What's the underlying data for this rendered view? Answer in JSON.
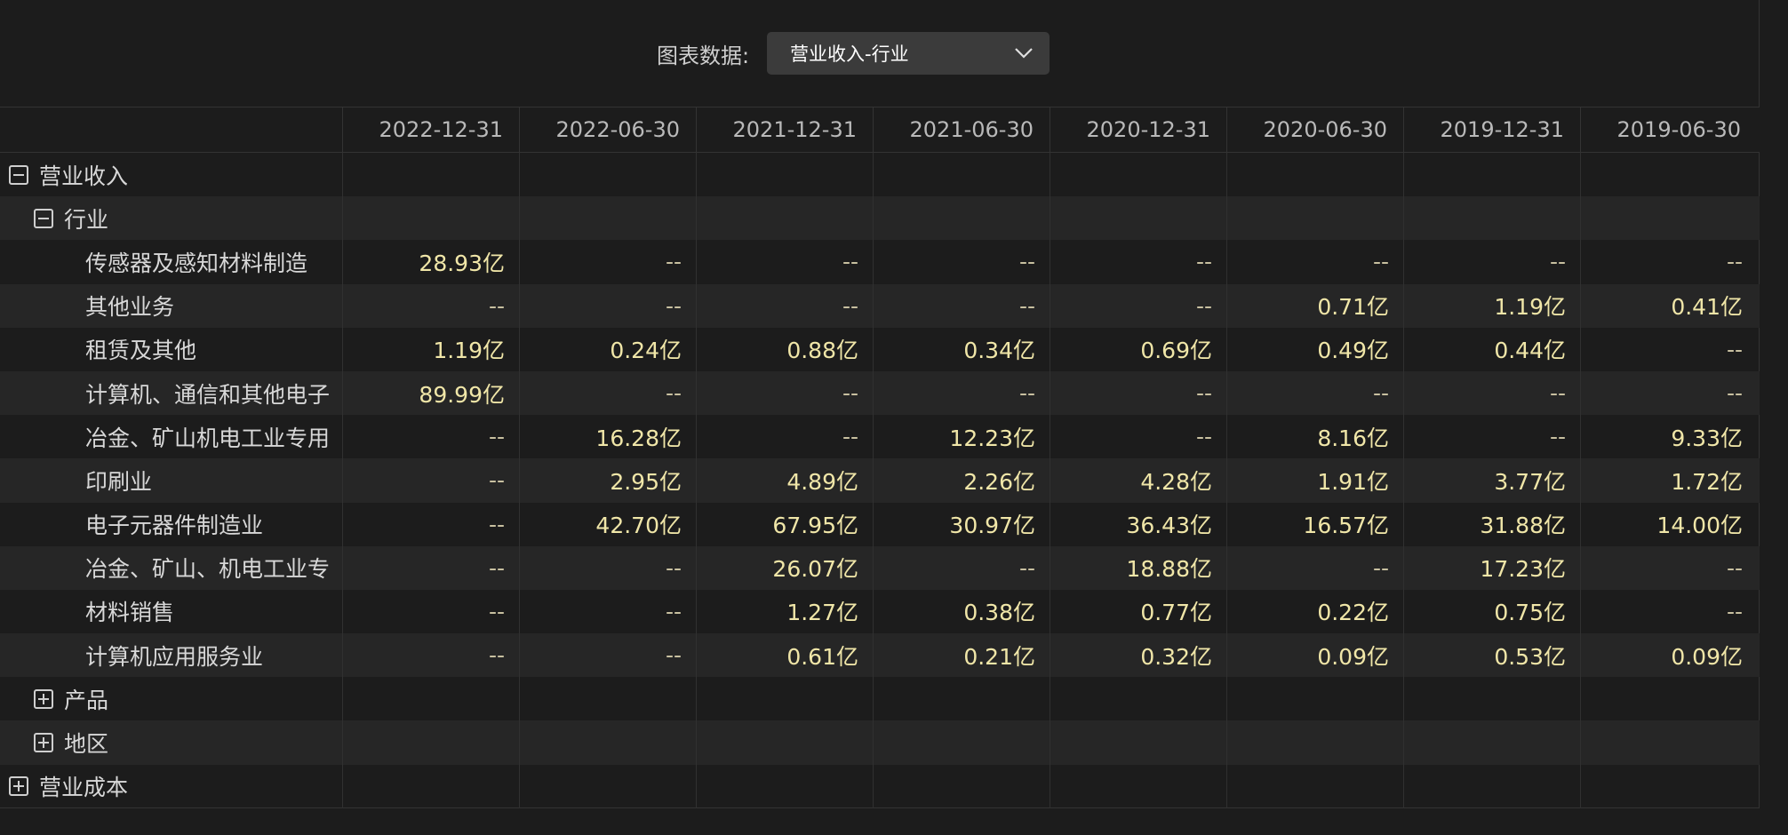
{
  "toolbar": {
    "label": "图表数据:",
    "select_value": "营业收入-行业",
    "select_icon": "chevron-down-icon"
  },
  "table": {
    "columns": [
      "2022-12-31",
      "2022-06-30",
      "2021-12-31",
      "2021-06-30",
      "2020-12-31",
      "2020-06-30",
      "2019-12-31",
      "2019-06-30"
    ],
    "rows": [
      {
        "label": "营业收入",
        "level": 0,
        "toggle": "collapse",
        "cells": [
          "",
          "",
          "",
          "",
          "",
          "",
          "",
          ""
        ]
      },
      {
        "label": "行业",
        "level": 1,
        "toggle": "collapse",
        "cells": [
          "",
          "",
          "",
          "",
          "",
          "",
          "",
          ""
        ]
      },
      {
        "label": "传感器及感知材料制造",
        "level": 2,
        "cells": [
          "28.93亿",
          "--",
          "--",
          "--",
          "--",
          "--",
          "--",
          "--"
        ]
      },
      {
        "label": "其他业务",
        "level": 2,
        "cells": [
          "--",
          "--",
          "--",
          "--",
          "--",
          "0.71亿",
          "1.19亿",
          "0.41亿"
        ]
      },
      {
        "label": "租赁及其他",
        "level": 2,
        "cells": [
          "1.19亿",
          "0.24亿",
          "0.88亿",
          "0.34亿",
          "0.69亿",
          "0.49亿",
          "0.44亿",
          "--"
        ]
      },
      {
        "label": "计算机、通信和其他电子",
        "level": 2,
        "cells": [
          "89.99亿",
          "--",
          "--",
          "--",
          "--",
          "--",
          "--",
          "--"
        ]
      },
      {
        "label": "冶金、矿山机电工业专用",
        "level": 2,
        "cells": [
          "--",
          "16.28亿",
          "--",
          "12.23亿",
          "--",
          "8.16亿",
          "--",
          "9.33亿"
        ]
      },
      {
        "label": "印刷业",
        "level": 2,
        "cells": [
          "--",
          "2.95亿",
          "4.89亿",
          "2.26亿",
          "4.28亿",
          "1.91亿",
          "3.77亿",
          "1.72亿"
        ]
      },
      {
        "label": "电子元器件制造业",
        "level": 2,
        "cells": [
          "--",
          "42.70亿",
          "67.95亿",
          "30.97亿",
          "36.43亿",
          "16.57亿",
          "31.88亿",
          "14.00亿"
        ]
      },
      {
        "label": "冶金、矿山、机电工业专",
        "level": 2,
        "cells": [
          "--",
          "--",
          "26.07亿",
          "--",
          "18.88亿",
          "--",
          "17.23亿",
          "--"
        ]
      },
      {
        "label": "材料销售",
        "level": 2,
        "cells": [
          "--",
          "--",
          "1.27亿",
          "0.38亿",
          "0.77亿",
          "0.22亿",
          "0.75亿",
          "--"
        ]
      },
      {
        "label": "计算机应用服务业",
        "level": 2,
        "cells": [
          "--",
          "--",
          "0.61亿",
          "0.21亿",
          "0.32亿",
          "0.09亿",
          "0.53亿",
          "0.09亿"
        ]
      },
      {
        "label": "产品",
        "level": 1,
        "toggle": "expand",
        "cells": [
          "",
          "",
          "",
          "",
          "",
          "",
          "",
          ""
        ]
      },
      {
        "label": "地区",
        "level": 1,
        "toggle": "expand",
        "cells": [
          "",
          "",
          "",
          "",
          "",
          "",
          "",
          ""
        ]
      },
      {
        "label": "营业成本",
        "level": 0,
        "toggle": "expand",
        "cells": [
          "",
          "",
          "",
          "",
          "",
          "",
          "",
          ""
        ]
      }
    ]
  },
  "colors": {
    "background": "#1c1c1c",
    "alt_row": "#262626",
    "value_text": "#f0e6a8",
    "select_bg": "#3b3b3b"
  }
}
